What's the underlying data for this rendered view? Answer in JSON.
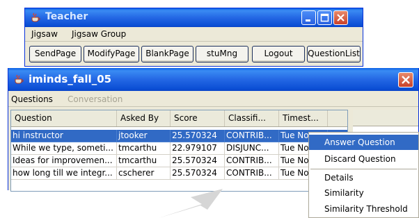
{
  "teacher_window": {
    "title": "Teacher",
    "menu": [
      "Jigsaw",
      "Jigsaw Group"
    ],
    "toolbar": [
      "SendPage",
      "ModifyPage",
      "BlankPage",
      "stuMng",
      "Logout",
      "QuestionList"
    ]
  },
  "iminds_window": {
    "title": "iminds_fall_05",
    "tabs": [
      {
        "label": "Questions",
        "enabled": true
      },
      {
        "label": "Conversation",
        "enabled": false
      }
    ],
    "table": {
      "columns": [
        "Question",
        "Asked By",
        "Score",
        "Classifi...",
        "Timest..."
      ],
      "rows": [
        {
          "question": "hi instructor",
          "asked_by": "jtooker",
          "score": "25.570324",
          "classification": "CONTRIB...",
          "timestamp": "Tue Nov",
          "selected": true
        },
        {
          "question": "While we type, someti...",
          "asked_by": "tmcarthu",
          "score": "22.979107",
          "classification": "DISJUNC...",
          "timestamp": "Tue Nov",
          "selected": false
        },
        {
          "question": "Ideas for improvemen...",
          "asked_by": "tmcarthu",
          "score": "25.570324",
          "classification": "CONTRIB...",
          "timestamp": "Tue Nov",
          "selected": false
        },
        {
          "question": "how long till we integr...",
          "asked_by": "cscherer",
          "score": "25.570324",
          "classification": "CONTRIB...",
          "timestamp": "Tue Nov",
          "selected": false
        }
      ]
    }
  },
  "context_menu": {
    "items": [
      "Answer Question",
      "Discard Question",
      "Details",
      "Similarity",
      "Similarity Threshold"
    ],
    "highlighted": "Answer Question"
  },
  "colors": {
    "titlebar_blue": "#2467e4",
    "selection_blue": "#316ac5",
    "window_face": "#ece9d8",
    "close_red": "#c9412a"
  },
  "icons": [
    "java-cup-icon",
    "minimize-icon",
    "maximize-icon",
    "close-icon"
  ]
}
